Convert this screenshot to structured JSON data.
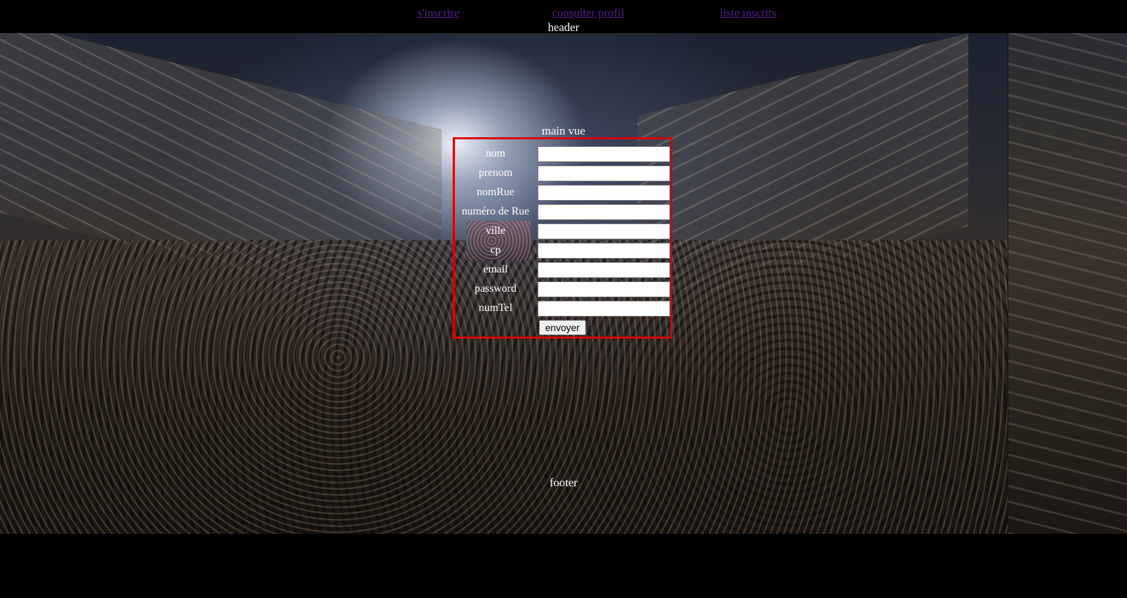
{
  "nav": {
    "links": [
      {
        "label": "s'inscrire"
      },
      {
        "label": "consulter profil"
      },
      {
        "label": "liste inscrits"
      }
    ],
    "link_color": "#551a8b"
  },
  "sections": {
    "header": "header",
    "main": "main vue",
    "footer": "footer"
  },
  "form": {
    "border_color": "#dd0000",
    "fields": [
      {
        "label": "nom",
        "value": ""
      },
      {
        "label": "prenom",
        "value": ""
      },
      {
        "label": "nomRue",
        "value": ""
      },
      {
        "label": "numéro de Rue",
        "value": ""
      },
      {
        "label": "ville",
        "value": ""
      },
      {
        "label": "cp",
        "value": ""
      },
      {
        "label": "email",
        "value": ""
      },
      {
        "label": "password",
        "value": ""
      },
      {
        "label": "numTel",
        "value": ""
      }
    ],
    "submit_label": "envoyer"
  }
}
